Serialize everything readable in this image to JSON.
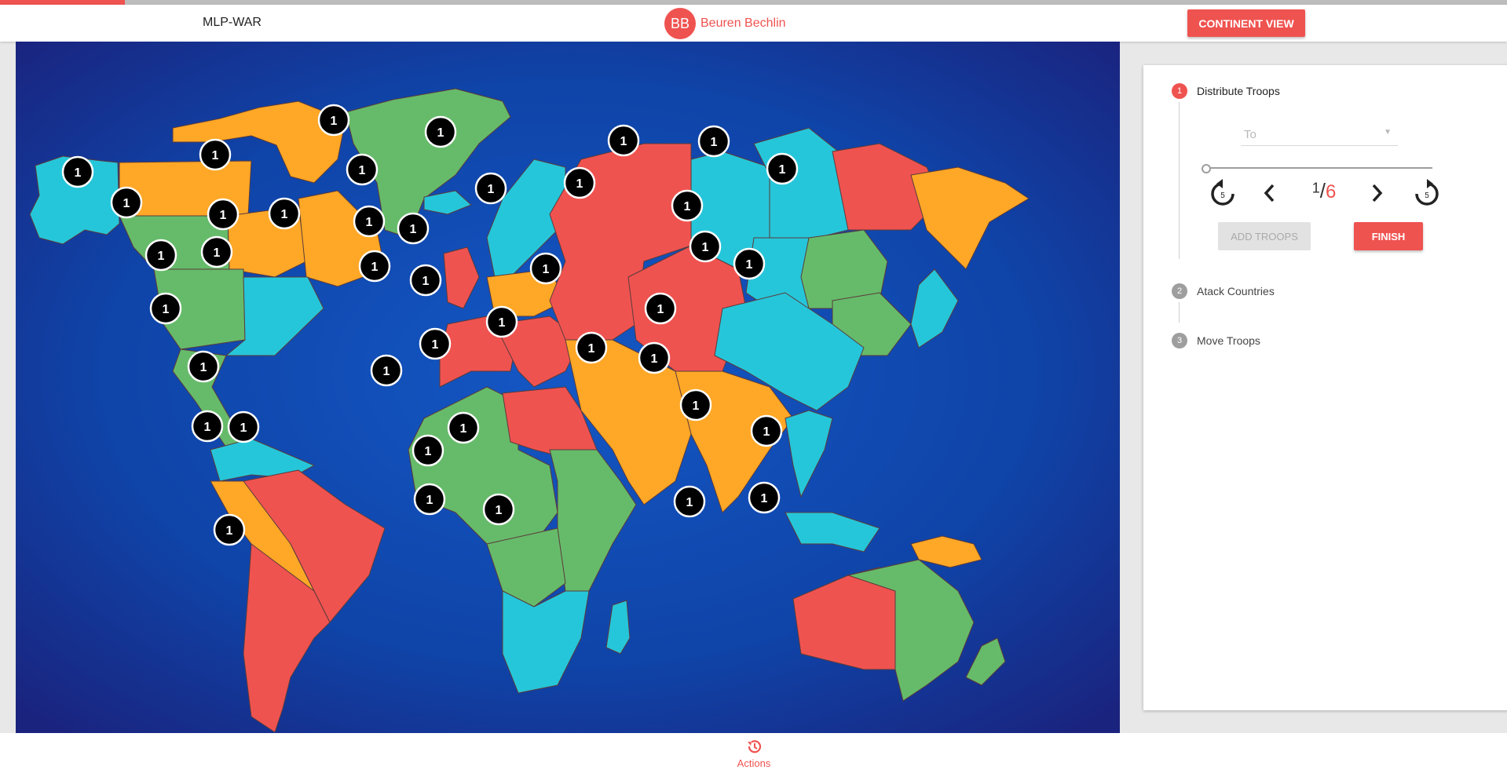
{
  "header": {
    "app_title": "MLP-WAR",
    "player_initials": "BB",
    "player_name": "Beuren Bechlin",
    "continent_view_label": "CONTINENT VIEW"
  },
  "turn_progress": 0.083,
  "colors": {
    "accent": "#ef5350",
    "ocean": "#0d3a99",
    "territory_red": "#ef5350",
    "territory_green": "#66bb6a",
    "territory_orange": "#ffa726",
    "territory_cyan": "#26c6da"
  },
  "map": {
    "troop_counts": [
      "1",
      "1",
      "1",
      "1",
      "1",
      "1",
      "1",
      "1",
      "1",
      "1",
      "1",
      "1",
      "1",
      "1",
      "1",
      "1",
      "1",
      "1",
      "1",
      "1",
      "1",
      "1",
      "1",
      "1",
      "1",
      "1",
      "1",
      "1",
      "1",
      "1",
      "1",
      "1",
      "1",
      "1",
      "1",
      "1",
      "1",
      "1",
      "1",
      "1",
      "1",
      "1"
    ]
  },
  "panel": {
    "steps": [
      {
        "number": "1",
        "label": "Distribute Troops",
        "active": true
      },
      {
        "number": "2",
        "label": "Atack Countries",
        "active": false
      },
      {
        "number": "3",
        "label": "Move Troops",
        "active": false
      }
    ],
    "to_placeholder": "To",
    "slider_value": 0,
    "rewind_5_label": "5",
    "forward_5_label": "5",
    "current": "1",
    "total": "6",
    "add_troops_label": "ADD TROOPS",
    "finish_label": "FINISH"
  },
  "footer": {
    "actions_label": "Actions",
    "actions_icon": "history-icon"
  }
}
